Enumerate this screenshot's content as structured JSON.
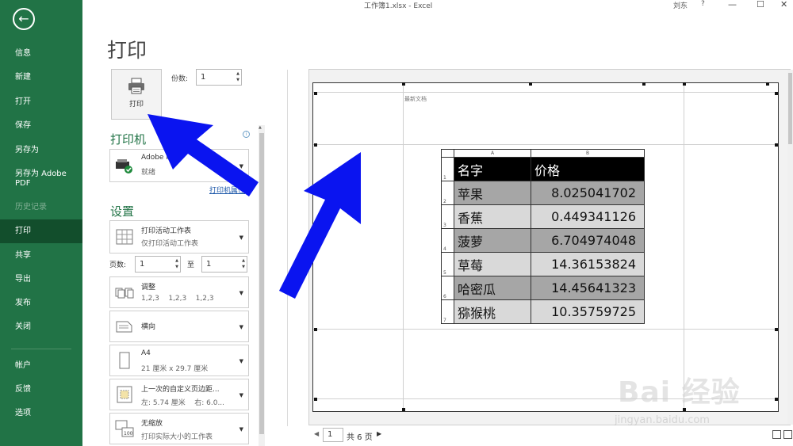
{
  "titlebar": {
    "doc_title": "工作簿1.xlsx  -  Excel",
    "user": "刘东",
    "help": "?",
    "minimize": "—",
    "restore": "☐",
    "close": "✕"
  },
  "nav": {
    "back_icon": "←",
    "items": [
      {
        "label": "信息"
      },
      {
        "label": "新建"
      },
      {
        "label": "打开"
      },
      {
        "label": "保存"
      },
      {
        "label": "另存为"
      },
      {
        "label": "另存为 Adobe PDF"
      },
      {
        "label": "历史记录"
      },
      {
        "label": "打印"
      },
      {
        "label": "共享"
      },
      {
        "label": "导出"
      },
      {
        "label": "发布"
      },
      {
        "label": "关闭"
      },
      {
        "label": "帐户"
      },
      {
        "label": "反馈"
      },
      {
        "label": "选项"
      }
    ],
    "active": "打印"
  },
  "print_panel": {
    "title": "打印",
    "print_button": "打印",
    "copies_label": "份数:",
    "copies_value": "1",
    "printer_heading": "打印机",
    "printer_name": "Adobe PDF",
    "printer_status": "就绪",
    "printer_properties": "打印机属性",
    "settings_heading": "设置",
    "settings": {
      "scope_title": "打印活动工作表",
      "scope_desc": "仅打印活动工作表",
      "pages_label": "页数:",
      "pages_from": "1",
      "to_label": "至",
      "pages_to": "1",
      "collate_title": "调整",
      "collate_desc": "1,2,3    1,2,3    1,2,3",
      "orientation": "横向",
      "paper_title": "A4",
      "paper_desc": "21 厘米 x 29.7 厘米",
      "margins_title": "上一次的自定义页边距...",
      "margins_desc": "左: 5.74 厘米    右: 6.0...",
      "scaling_title": "无缩放",
      "scaling_desc": "打印实际大小的工作表"
    }
  },
  "preview": {
    "header_text": "最新文档",
    "col_headers": [
      "A",
      "B"
    ],
    "row_numbers": [
      "1",
      "2",
      "3",
      "4",
      "5",
      "6",
      "7"
    ],
    "table": {
      "header": [
        "名字",
        "价格"
      ],
      "rows": [
        [
          "苹果",
          "8.025041702"
        ],
        [
          "香蕉",
          "0.449341126"
        ],
        [
          "菠萝",
          "6.704974048"
        ],
        [
          "草莓",
          "14.36153824"
        ],
        [
          "哈密瓜",
          "14.45641323"
        ],
        [
          "猕猴桃",
          "10.35759725"
        ]
      ]
    },
    "page_current": "1",
    "page_total": "共 6 页"
  },
  "watermark": {
    "brand": "Bai 经验",
    "url": "jingyan.baidu.com"
  },
  "colors": {
    "accent_green": "#217346",
    "active_nav": "#124e2c",
    "annotation_arrow": "#0a14f0"
  }
}
